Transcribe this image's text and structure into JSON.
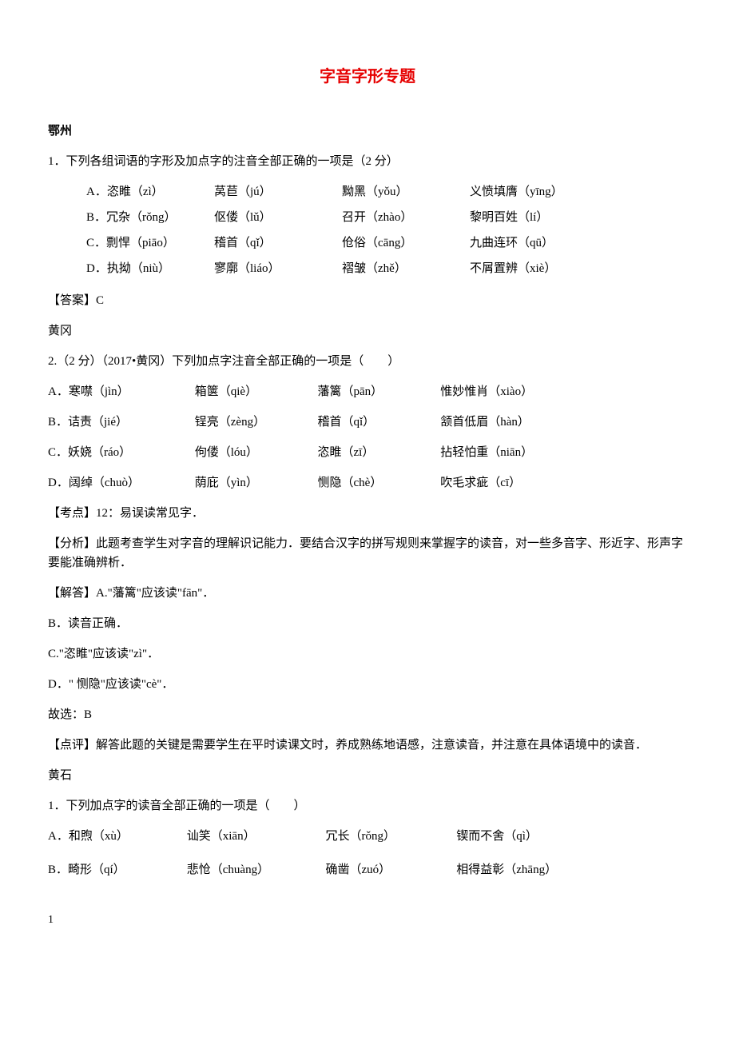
{
  "title": "字音字形专题",
  "section1": {
    "header": "鄂州",
    "question": "1．下列各组词语的字形及加点字的注音全部正确的一项是（2 分）",
    "options": [
      [
        "A．恣睢（zì）",
        "莴苣（jú）",
        "黝黑（yǒu）",
        "义愤填膺（yīng）"
      ],
      [
        "B．冗杂（rǒng）",
        "伛偻（lǔ）",
        "召开（zhào）",
        "黎明百姓（lí）"
      ],
      [
        "C．剽悍（piāo）",
        "稽首（qǐ）",
        "伧俗（cāng）",
        "九曲连环（qū）"
      ],
      [
        "D．执拗（niù）",
        "寥廓（liáo）",
        "褶皱（zhě）",
        "不屑置辨（xiè）"
      ]
    ],
    "answer": "【答案】C"
  },
  "section2": {
    "header": "黄冈",
    "question": "2.（2 分）（2017•黄冈）下列加点字注音全部正确的一项是（　　）",
    "options": [
      [
        "A．寒噤（jìn）",
        "箱箧（qiè）",
        "藩篱（pān）",
        "惟妙惟肖（xiào）"
      ],
      [
        "B．诘责（jié）",
        "锃亮（zèng）",
        "稽首（qǐ）",
        "颔首低眉（hàn）"
      ],
      [
        "C．妖娆（ráo）",
        "佝偻（lóu）",
        "恣睢（zī）",
        "拈轻怕重（niān）"
      ],
      [
        "D．阔绰（chuò）",
        "荫庇（yìn）",
        "恻隐（chè）",
        "吹毛求疵（cī）"
      ]
    ],
    "kaodian": "【考点】12：易误读常见字．",
    "fenxi": "【分析】此题考查学生对字音的理解识记能力．要结合汉字的拼写规则来掌握字的读音，对一些多音字、形近字、形声字要能准确辨析．",
    "jieda_lines": [
      "【解答】A.\"藩篱\"应该读\"fān\"．",
      "B．读音正确．",
      "C.\"恣睢\"应该读\"zì\"．",
      "D．\" 恻隐\"应该读\"cè\"．",
      "故选：B"
    ],
    "dianping": "【点评】解答此题的关键是需要学生在平时读课文时，养成熟练地语感，注意读音，并注意在具体语境中的读音．"
  },
  "section3": {
    "header": "黄石",
    "question": "1．下列加点字的读音全部正确的一项是（　　）",
    "options": [
      [
        "A．和煦（xù）",
        "讪笑（xiān）",
        "冗长（rǒng）",
        "锲而不舍（qì）"
      ],
      [
        "B．畸形（qí）",
        "悲怆（chuàng）",
        "确凿（zuó）",
        "相得益彰（zhāng）"
      ]
    ]
  },
  "page_number": "1"
}
